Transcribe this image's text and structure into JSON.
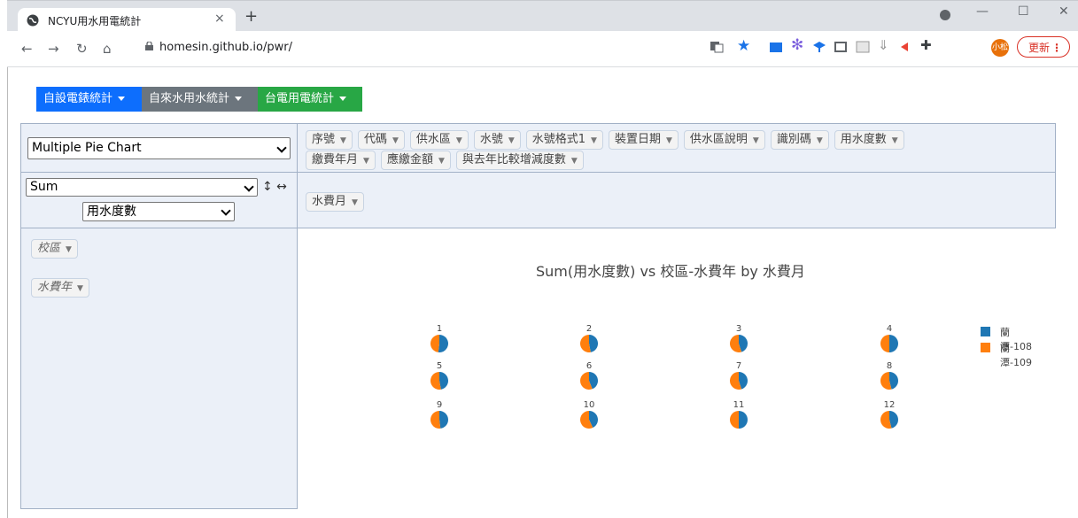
{
  "browser": {
    "tab_title": "NCYU用水用電統計",
    "tab_close": "×",
    "new_tab": "+",
    "url": "homesin.github.io/pwr/",
    "avatar_text": "小松",
    "update_label": "更新",
    "update_menu": "⋮",
    "minimize": "—",
    "maximize": "☐",
    "close": "✕"
  },
  "topnav": [
    {
      "label": "自設電錶統計",
      "color": "#0d6efd"
    },
    {
      "label": "自來水用水統計",
      "color": "#6c757d"
    },
    {
      "label": "台電用電統計",
      "color": "#28a745"
    }
  ],
  "pivot": {
    "renderer": "Multiple Pie Chart",
    "aggregator": "Sum",
    "aggregator_field": "用水度數",
    "sort_icons": "↕ ↔",
    "unused_fields": [
      "序號",
      "代碼",
      "供水區",
      "水號",
      "水號格式1",
      "裝置日期",
      "供水區說明",
      "識別碼",
      "用水度數",
      "繳費年月",
      "應繳金額",
      "與去年比較增減度數"
    ],
    "col_fields": [
      "水費月"
    ],
    "row_fields": [
      "校區",
      "水費年"
    ]
  },
  "chart_data": {
    "type": "pie",
    "title": "Sum(用水度數) vs 校區-水費年 by 水費月",
    "legend_position": "right",
    "series_names": [
      "蘭潭-108",
      "蘭潭-109"
    ],
    "colors": [
      "#1f77b4",
      "#ff7f0e"
    ],
    "pies": [
      {
        "label": "1",
        "values": [
          52,
          48
        ]
      },
      {
        "label": "2",
        "values": [
          47,
          53
        ]
      },
      {
        "label": "3",
        "values": [
          45,
          55
        ]
      },
      {
        "label": "4",
        "values": [
          50,
          50
        ]
      },
      {
        "label": "5",
        "values": [
          47,
          53
        ]
      },
      {
        "label": "6",
        "values": [
          44,
          56
        ]
      },
      {
        "label": "7",
        "values": [
          45,
          55
        ]
      },
      {
        "label": "8",
        "values": [
          46,
          54
        ]
      },
      {
        "label": "9",
        "values": [
          48,
          52
        ]
      },
      {
        "label": "10",
        "values": [
          43,
          57
        ]
      },
      {
        "label": "11",
        "values": [
          50,
          50
        ]
      },
      {
        "label": "12",
        "values": [
          46,
          54
        ]
      }
    ]
  }
}
